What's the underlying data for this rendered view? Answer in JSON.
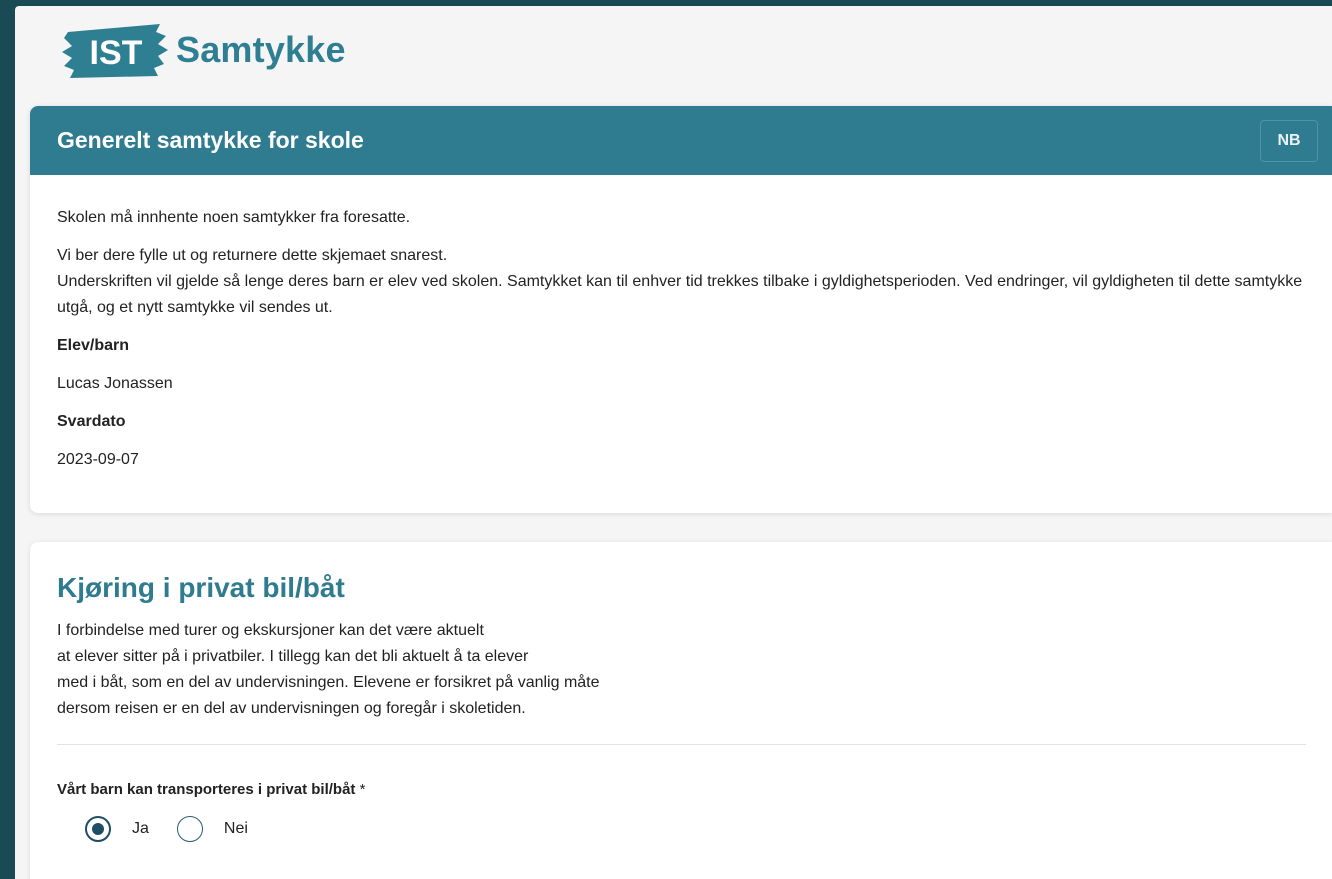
{
  "app": {
    "logo_text": "IST",
    "name": "Samtykke"
  },
  "consent_card": {
    "title": "Generelt samtykke for skole",
    "language_button": "NB",
    "paragraph1": "Skolen må innhente noen samtykker fra foresatte.",
    "paragraph2_line1": "Vi ber dere fylle ut og returnere dette skjemaet snarest.",
    "paragraph2_line2": "Underskriften vil gjelde så lenge deres barn er elev ved skolen. Samtykket kan til enhver tid trekkes tilbake i gyldighetsperioden. Ved endringer, vil gyldigheten til dette samtykke utgå, og et nytt samtykke vil sendes ut.",
    "student_label": "Elev/barn",
    "student_name": "Lucas Jonassen",
    "reply_date_label": "Svardato",
    "reply_date": "2023-09-07"
  },
  "section": {
    "title": "Kjøring i privat bil/båt",
    "text_line1": "I forbindelse med turer og ekskursjoner kan det være aktuelt",
    "text_line2": "at elever sitter på i privatbiler. I tillegg kan det bli aktuelt å ta elever",
    "text_line3": "med i båt, som en del av undervisningen. Elevene er forsikret på vanlig måte",
    "text_line4": "dersom reisen er en del av undervisningen og foregår i skoletiden.",
    "question": "Vårt barn kan transporteres i privat bil/båt",
    "required_mark": "*",
    "options": [
      {
        "label": "Ja",
        "selected": true
      },
      {
        "label": "Nei",
        "selected": false
      }
    ]
  },
  "colors": {
    "brand": "#2f7b90",
    "frame": "#1a4b55",
    "radio": "#1f4d63"
  }
}
